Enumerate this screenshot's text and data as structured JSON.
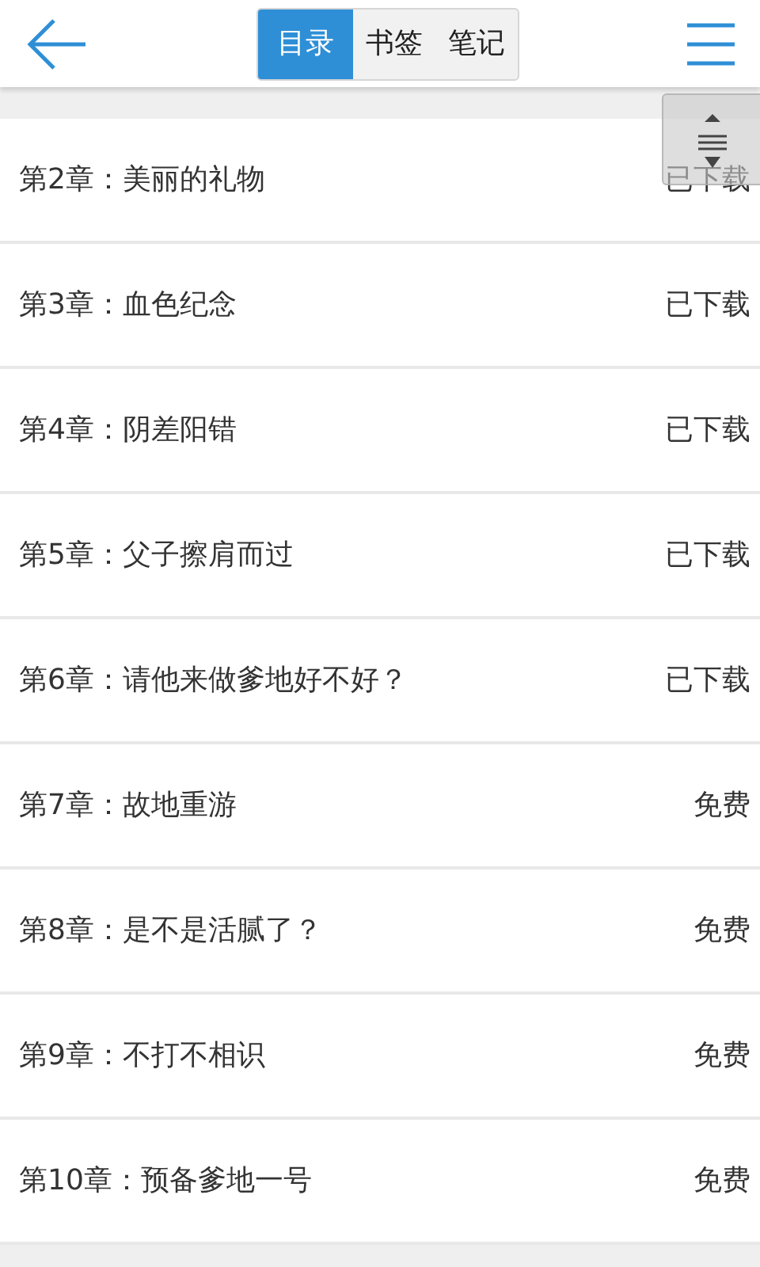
{
  "tabs": [
    {
      "label": "目录",
      "selected": true
    },
    {
      "label": "书签",
      "selected": false
    },
    {
      "label": "笔记",
      "selected": false
    }
  ],
  "chapters": [
    {
      "title": "第2章：美丽的礼物",
      "status": "已下载"
    },
    {
      "title": "第3章：血色纪念",
      "status": "已下载"
    },
    {
      "title": "第4章：阴差阳错",
      "status": "已下载"
    },
    {
      "title": "第5章：父子擦肩而过",
      "status": "已下载"
    },
    {
      "title": "第6章：请他来做爹地好不好？",
      "status": "已下载"
    },
    {
      "title": "第7章：故地重游",
      "status": "免费"
    },
    {
      "title": "第8章：是不是活腻了？",
      "status": "免费"
    },
    {
      "title": "第9章：不打不相识",
      "status": "免费"
    },
    {
      "title": "第10章：预备爹地一号",
      "status": "免费"
    }
  ]
}
